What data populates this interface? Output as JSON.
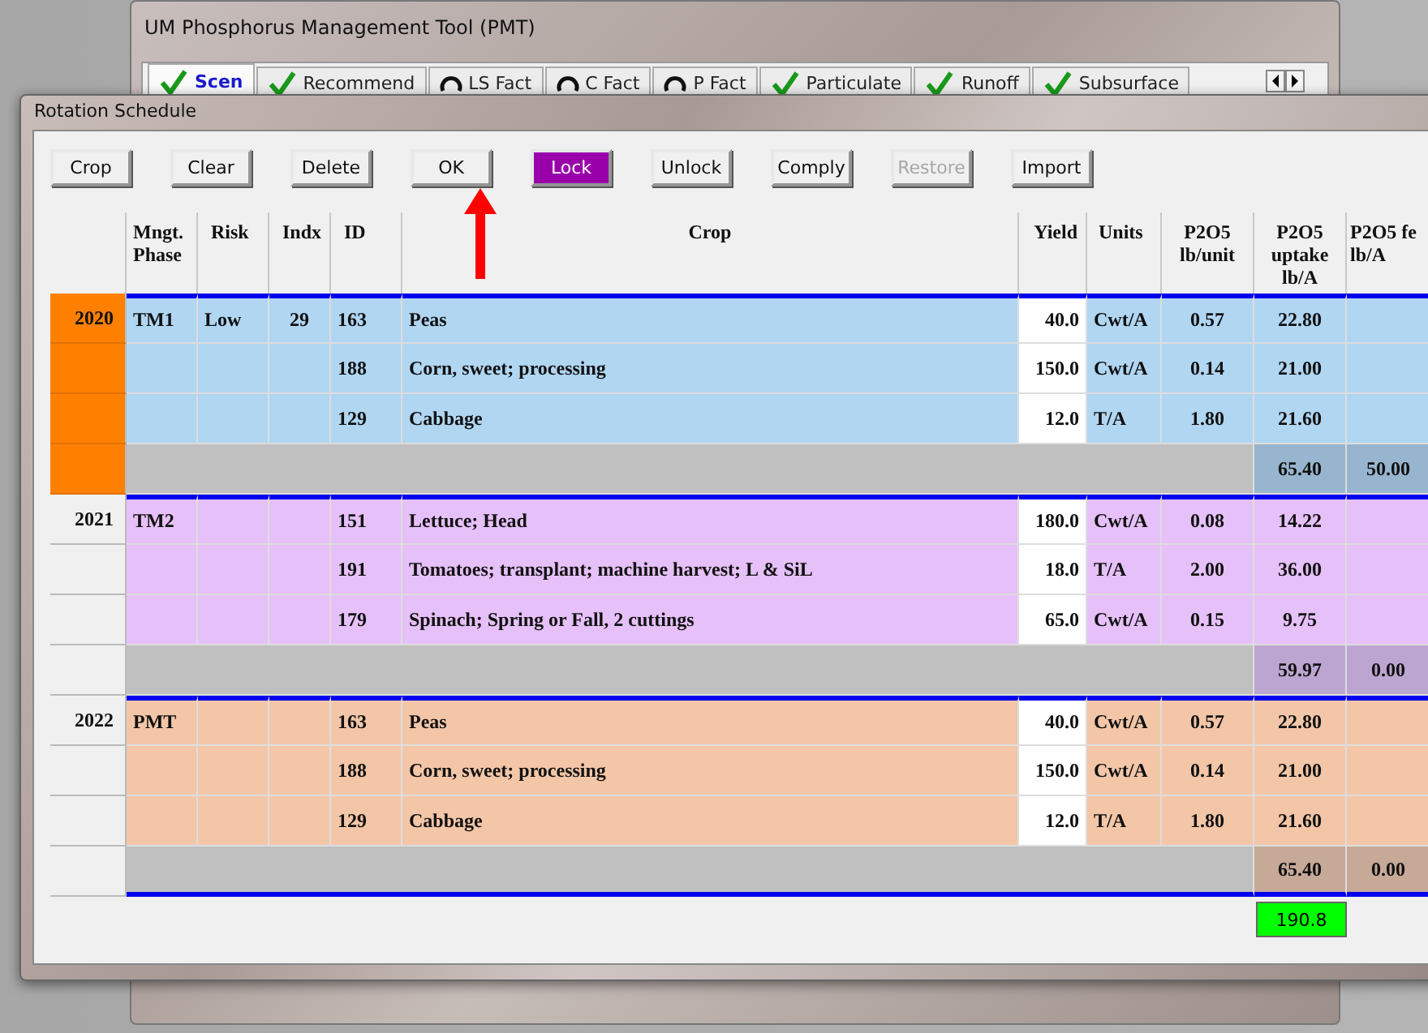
{
  "main_window": {
    "title": "UM Phosphorus Management Tool (PMT)",
    "tabs": [
      {
        "label": "Scen",
        "kind": "check",
        "selected": true
      },
      {
        "label": "Recommend",
        "kind": "check",
        "selected": false
      },
      {
        "label": "LS Fact",
        "kind": "ring",
        "selected": false
      },
      {
        "label": "C  Fact",
        "kind": "ring",
        "selected": false
      },
      {
        "label": "P Fact",
        "kind": "ring",
        "selected": false
      },
      {
        "label": "Particulate",
        "kind": "check",
        "selected": false
      },
      {
        "label": "Runoff",
        "kind": "check",
        "selected": false
      },
      {
        "label": "Subsurface",
        "kind": "check",
        "selected": false
      }
    ]
  },
  "dialog": {
    "title": "Rotation Schedule",
    "buttons": [
      {
        "label": "Crop",
        "active": false,
        "disabled": false
      },
      {
        "label": "Clear",
        "active": false,
        "disabled": false
      },
      {
        "label": "Delete",
        "active": false,
        "disabled": false
      },
      {
        "label": "OK",
        "active": false,
        "disabled": false
      },
      {
        "label": "Lock",
        "active": true,
        "disabled": false
      },
      {
        "label": "Unlock",
        "active": false,
        "disabled": false
      },
      {
        "label": "Comply",
        "active": false,
        "disabled": false
      },
      {
        "label": "Restore",
        "active": false,
        "disabled": true
      },
      {
        "label": "Import",
        "active": false,
        "disabled": false
      }
    ],
    "table": {
      "columns": [
        "Mngt.\nPhase",
        "Risk",
        "Indx",
        "ID",
        "Crop",
        "Yield",
        "Units",
        "P2O5\nlb/unit",
        "P2O5\nuptake\nlb/A",
        "P2O5 fe\nlb/A"
      ],
      "groups": [
        {
          "year": "2020",
          "selected": true,
          "phase": "TM1",
          "risk": "Low",
          "indx": "29",
          "color": "#b0d6f2",
          "rows": [
            {
              "id": "163",
              "crop": "Peas",
              "yield": "40.0",
              "units": "Cwt/A",
              "lb_unit": "0.57",
              "uptake": "22.80"
            },
            {
              "id": "188",
              "crop": "Corn, sweet; processing",
              "yield": "150.0",
              "units": "Cwt/A",
              "lb_unit": "0.14",
              "uptake": "21.00"
            },
            {
              "id": "129",
              "crop": "Cabbage",
              "yield": "12.0",
              "units": "T/A",
              "lb_unit": "1.80",
              "uptake": "21.60"
            }
          ],
          "subtotal": {
            "uptake": "65.40",
            "fert": "50.00"
          }
        },
        {
          "year": "2021",
          "selected": false,
          "phase": "TM2",
          "color": "#e6c0f8",
          "rows": [
            {
              "id": "151",
              "crop": "Lettuce; Head",
              "yield": "180.0",
              "units": "Cwt/A",
              "lb_unit": "0.08",
              "uptake": "14.22"
            },
            {
              "id": "191",
              "crop": "Tomatoes; transplant; machine harvest; L & SiL",
              "yield": "18.0",
              "units": "T/A",
              "lb_unit": "2.00",
              "uptake": "36.00"
            },
            {
              "id": "179",
              "crop": "Spinach; Spring or Fall, 2 cuttings",
              "yield": "65.0",
              "units": "Cwt/A",
              "lb_unit": "0.15",
              "uptake": "9.75"
            }
          ],
          "subtotal": {
            "uptake": "59.97",
            "fert": "0.00"
          }
        },
        {
          "year": "2022",
          "selected": false,
          "phase": "PMT",
          "color": "#f3c6a8",
          "rows": [
            {
              "id": "163",
              "crop": "Peas",
              "yield": "40.0",
              "units": "Cwt/A",
              "lb_unit": "0.57",
              "uptake": "22.80"
            },
            {
              "id": "188",
              "crop": "Corn, sweet; processing",
              "yield": "150.0",
              "units": "Cwt/A",
              "lb_unit": "0.14",
              "uptake": "21.00"
            },
            {
              "id": "129",
              "crop": "Cabbage",
              "yield": "12.0",
              "units": "T/A",
              "lb_unit": "1.80",
              "uptake": "21.60"
            }
          ],
          "subtotal": {
            "uptake": "65.40",
            "fert": "0.00"
          }
        }
      ],
      "total": "190.8"
    }
  }
}
